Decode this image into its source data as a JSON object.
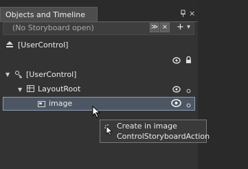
{
  "panel": {
    "title": "Objects and Timeline",
    "storyboard_placeholder": "(No Storyboard open)",
    "pin_icon": "pin-icon",
    "close_glyph": "×"
  },
  "toolbar": {
    "collapse_glyph": "≫",
    "close_storyboard_glyph": "×",
    "add_glyph": "+",
    "dropdown_glyph": "▾"
  },
  "tree": {
    "scope_label": "[UserControl]",
    "root_label": "[UserControl]",
    "layoutroot_label": "LayoutRoot",
    "image_label": "image"
  },
  "tooltip": {
    "line1": "Create in image",
    "line2": "ControlStoryboardAction"
  },
  "colors": {
    "selection_fill": "#4d5663",
    "selection_border": "#8f9fb6",
    "panel_bg": "#333333"
  }
}
